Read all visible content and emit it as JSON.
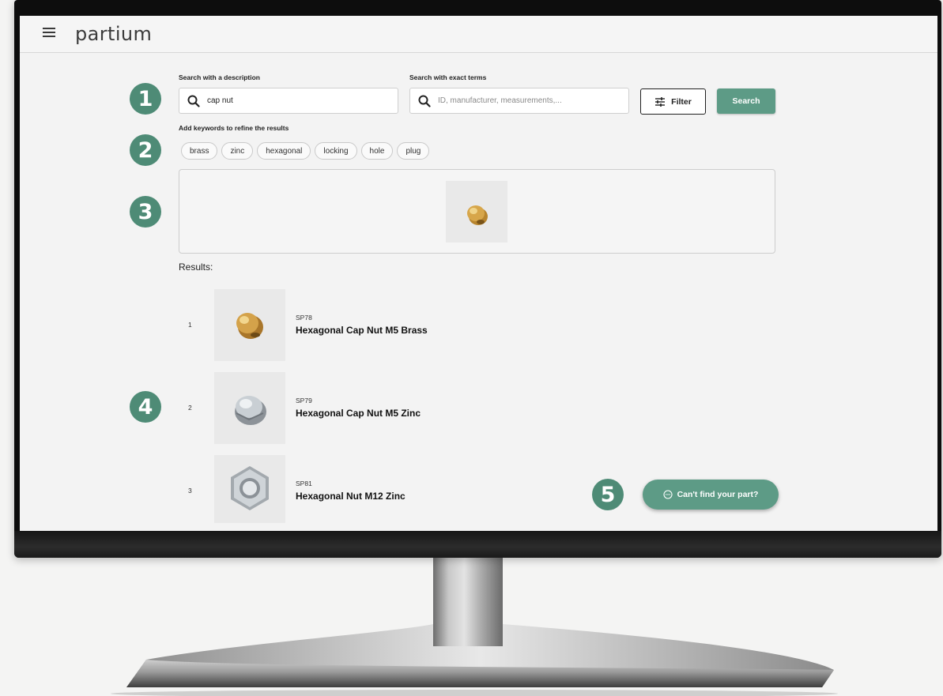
{
  "app": {
    "brand": "partium"
  },
  "search": {
    "description_label": "Search with a description",
    "description_value": "cap nut",
    "exact_label": "Search with exact terms",
    "exact_placeholder": "ID, manufacturer, measurements,...",
    "filter_label": "Filter",
    "search_label": "Search",
    "keywords_label": "Add keywords to refine the results",
    "keywords": [
      "brass",
      "zinc",
      "hexagonal",
      "locking",
      "hole",
      "plug"
    ]
  },
  "results": {
    "label": "Results:",
    "items": [
      {
        "index": "1",
        "code": "SP78",
        "name": "Hexagonal Cap Nut M5 Brass"
      },
      {
        "index": "2",
        "code": "SP79",
        "name": "Hexagonal Cap Nut M5 Zinc"
      },
      {
        "index": "3",
        "code": "SP81",
        "name": "Hexagonal Nut M12 Zinc"
      }
    ]
  },
  "help": {
    "cant_find_label": "Can't find your part?"
  },
  "badges": [
    "1",
    "2",
    "3",
    "4",
    "5"
  ],
  "colors": {
    "accent": "#5d9b86",
    "badge": "#4e8b76"
  }
}
